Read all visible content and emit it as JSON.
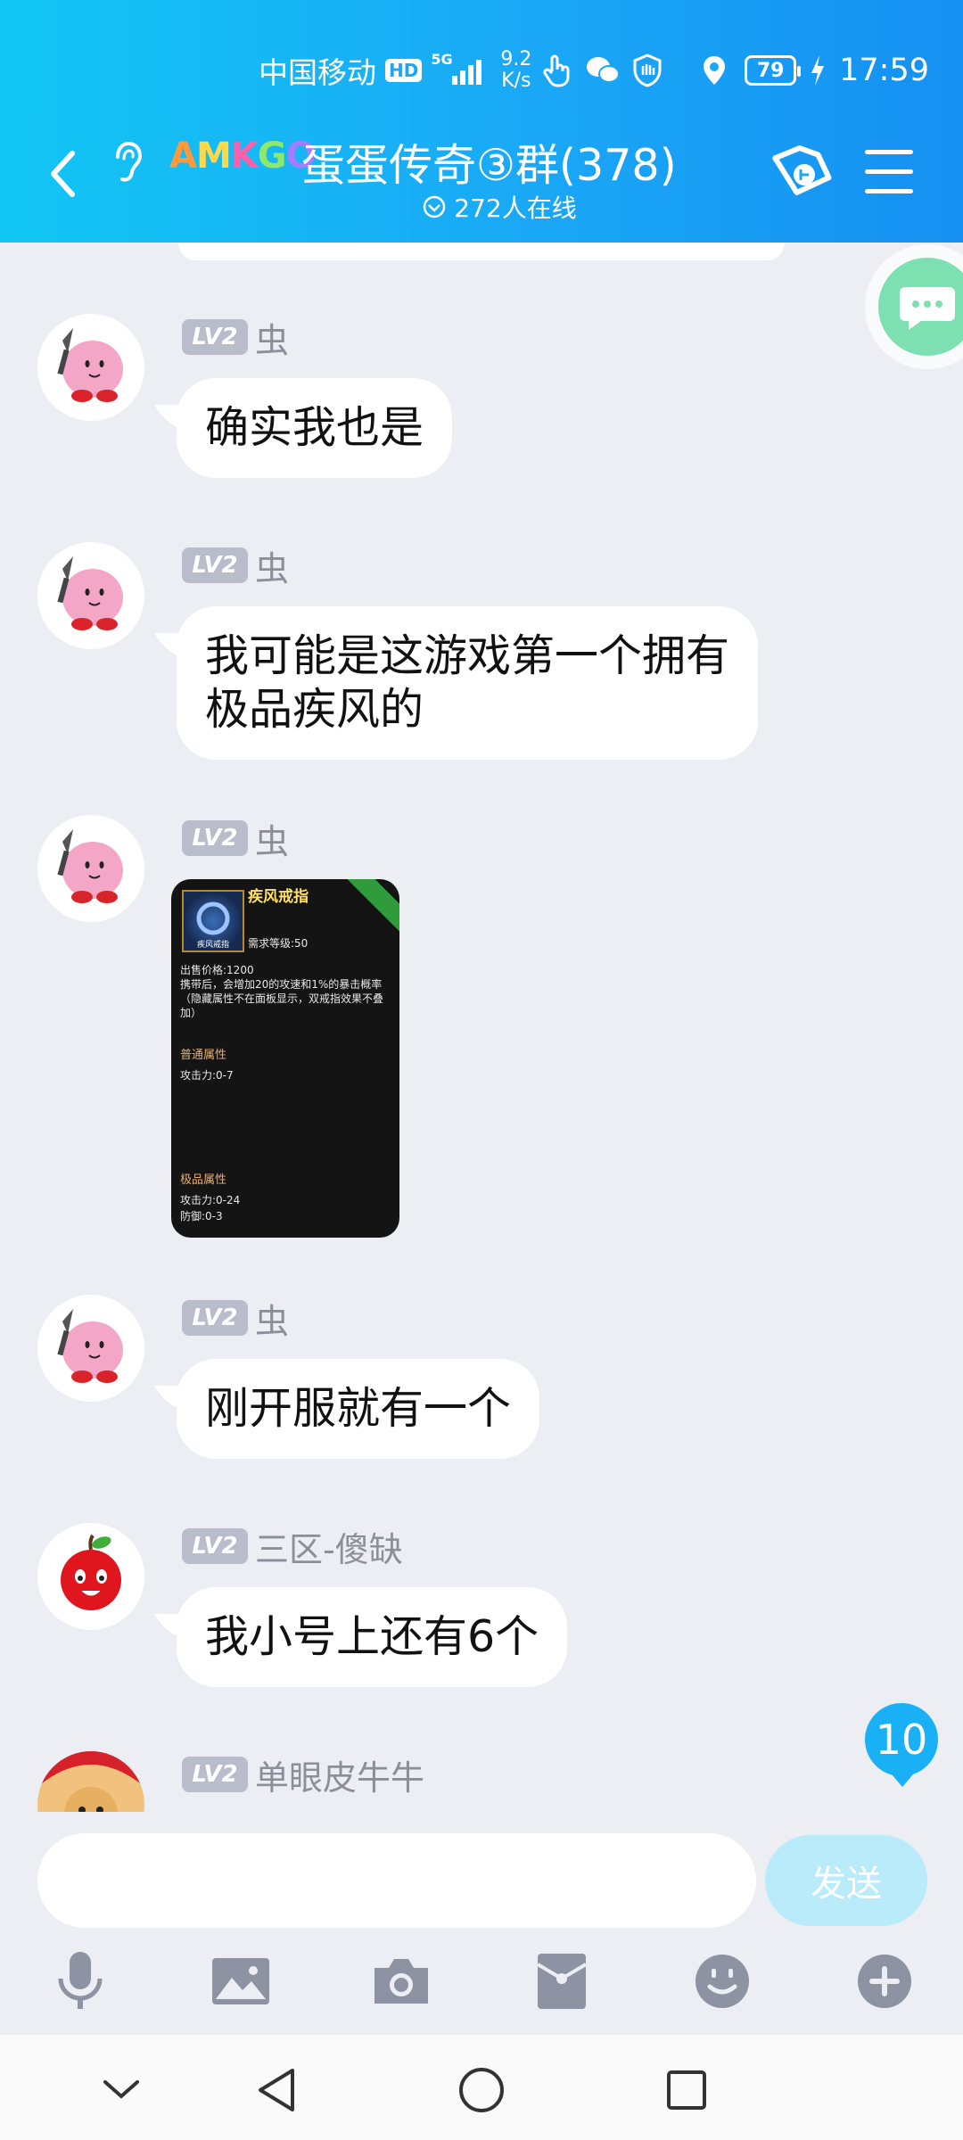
{
  "status_bar": {
    "carrier": "中国移动",
    "hd": "HD",
    "network": "5G",
    "net_speed_value": "9.2",
    "net_speed_unit": "K/s",
    "battery": "79",
    "time": "17:59"
  },
  "header": {
    "brand": [
      "A",
      "M",
      "K",
      "G",
      "O"
    ],
    "title": "蛋蛋传奇③群(378)",
    "online": "272人在线"
  },
  "messages": [
    {
      "level": "LV2",
      "sender": "虫",
      "text": "确实我也是"
    },
    {
      "level": "LV2",
      "sender": "虫",
      "line1": "我可能是这游戏第一个拥有",
      "line2": "极品疾风的"
    },
    {
      "level": "LV2",
      "sender": "虫",
      "item_card": {
        "name": "疾风戒指",
        "icon_label": "疾风戒指",
        "requirement": "需求等级:50",
        "price": "出售价格:1200",
        "description": "携带后，会增加20的攻速和1%的暴击概率（隐藏属性不在面板显示，双戒指效果不叠加）",
        "normal_title": "普通属性",
        "normal_attack": "攻击力:0-7",
        "rare_title": "极品属性",
        "rare_attack": "攻击力:0-24",
        "rare_defense": "防御:0-3"
      }
    },
    {
      "level": "LV2",
      "sender": "虫",
      "text": "刚开服就有一个"
    },
    {
      "level": "LV2",
      "sender": "三区-傻缺",
      "text": "我小号上还有6个"
    },
    {
      "level": "LV2",
      "sender": "单眼皮牛牛"
    }
  ],
  "unread_count": "10",
  "input": {
    "placeholder": "",
    "send_label": "发送"
  },
  "colors": {
    "header_start": "#12c6f4",
    "header_end": "#1590f2",
    "send_disabled": "#b9ebfa",
    "badge": "#1ab0f5"
  }
}
